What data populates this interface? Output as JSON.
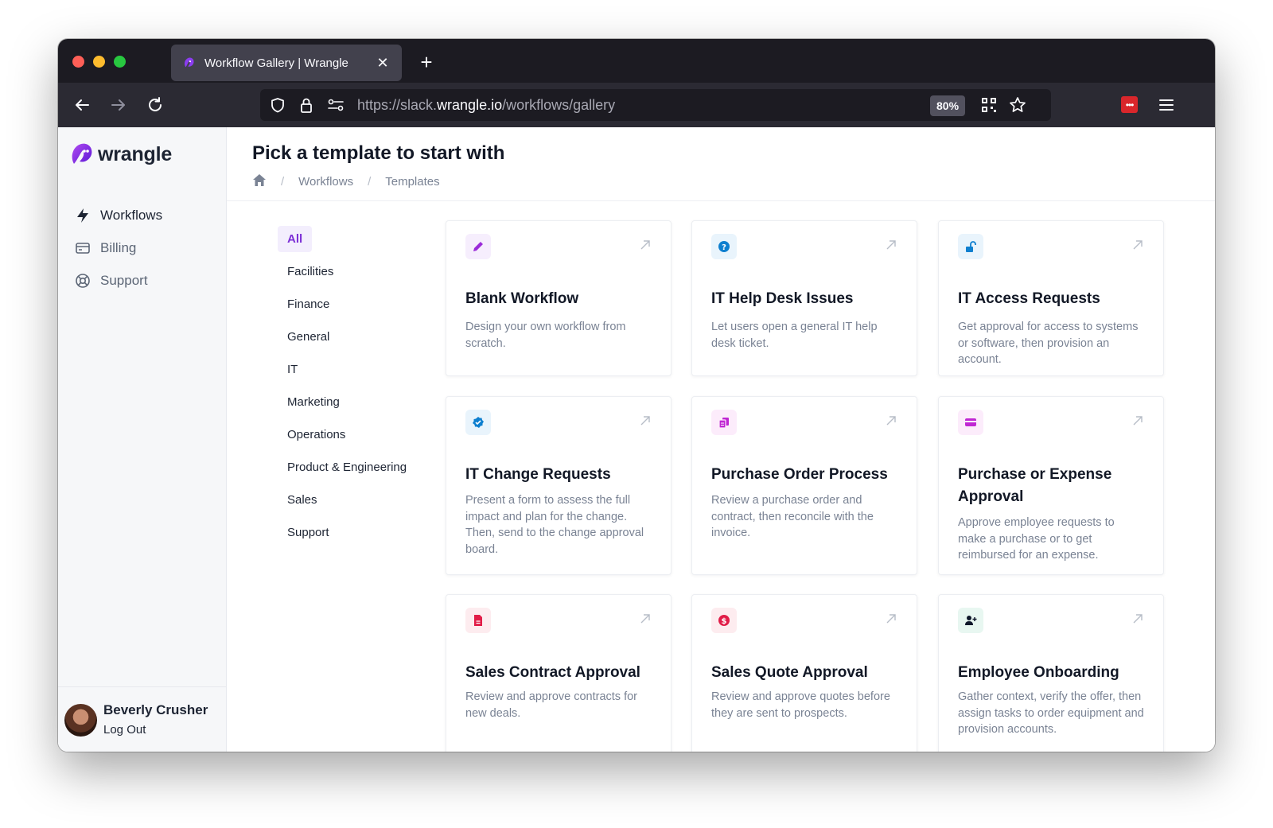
{
  "browser": {
    "tab_title": "Workflow Gallery | Wrangle",
    "url_prefix": "https://slack.",
    "url_host": "wrangle.io",
    "url_path": "/workflows/gallery",
    "zoom": "80%"
  },
  "brand": {
    "name": "wrangle",
    "accent": "#7c2fd6"
  },
  "sidebar": {
    "items": [
      {
        "label": "Workflows",
        "icon": "lightning-icon"
      },
      {
        "label": "Billing",
        "icon": "credit-card-icon"
      },
      {
        "label": "Support",
        "icon": "lifebuoy-icon"
      }
    ]
  },
  "user": {
    "name": "Beverly Crusher",
    "logout": "Log Out"
  },
  "header": {
    "title": "Pick a template to start with",
    "breadcrumbs": [
      "Workflows",
      "Templates"
    ]
  },
  "filters": [
    "All",
    "Facilities",
    "Finance",
    "General",
    "IT",
    "Marketing",
    "Operations",
    "Product & Engineering",
    "Sales",
    "Support"
  ],
  "active_filter": "All",
  "cards": [
    {
      "title": "Blank Workflow",
      "desc": "Design your own workflow from scratch.",
      "icon": "pencil-icon",
      "color": "#9b2bd9",
      "bg": "#f6eefd"
    },
    {
      "title": "IT Help Desk Issues",
      "desc": "Let users open a general IT help desk ticket.",
      "icon": "question-icon",
      "color": "#0e7fcf",
      "bg": "#e9f4fc"
    },
    {
      "title": "IT Access Requests",
      "desc": "Get approval for access to systems or software, then provision an account.",
      "icon": "unlock-icon",
      "color": "#0e7fcf",
      "bg": "#e9f4fc"
    },
    {
      "title": "IT Change Requests",
      "desc": "Present a form to assess the full impact and plan for the change. Then, send to the change approval board.",
      "icon": "check-badge-icon",
      "color": "#0e7fcf",
      "bg": "#e9f4fc"
    },
    {
      "title": "Purchase Order Process",
      "desc": "Review a purchase order and contract, then reconcile with the invoice.",
      "icon": "documents-icon",
      "color": "#c026d3",
      "bg": "#fcecfb"
    },
    {
      "title": "Purchase or Expense Approval",
      "desc": "Approve employee requests to make a purchase or to get reimbursed for an expense.",
      "icon": "credit-card-icon",
      "color": "#c026d3",
      "bg": "#fcecfb"
    },
    {
      "title": "Sales Contract Approval",
      "desc": "Review and approve contracts for new deals.",
      "icon": "document-icon",
      "color": "#e11d48",
      "bg": "#fdecef"
    },
    {
      "title": "Sales Quote Approval",
      "desc": "Review and approve quotes before they are sent to prospects.",
      "icon": "dollar-icon",
      "color": "#e11d48",
      "bg": "#fdecef"
    },
    {
      "title": "Employee Onboarding",
      "desc": "Gather context, verify the offer, then assign tasks to order equipment and provision accounts.",
      "icon": "user-add-icon",
      "color": "#0f172a",
      "bg": "#e8f7f1"
    }
  ]
}
